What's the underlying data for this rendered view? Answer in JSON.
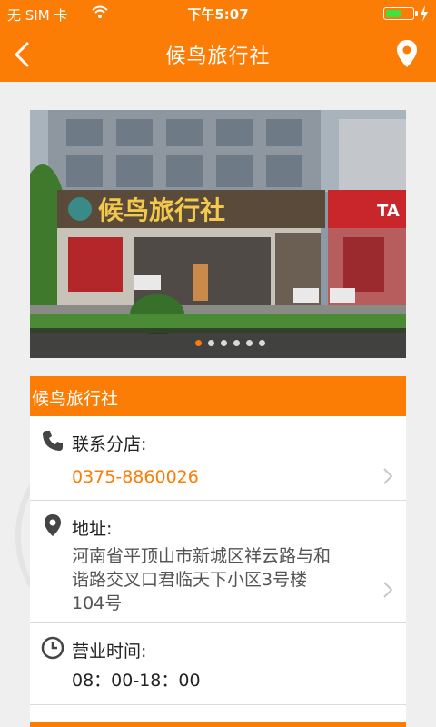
{
  "status_bar": {
    "carrier": "无 SIM 卡",
    "time": "下午5:07",
    "battery_level": 0.5
  },
  "nav": {
    "title": "候鸟旅行社",
    "back_icon": "chevron-left-icon",
    "location_icon": "map-pin-icon"
  },
  "gallery": {
    "storefront_sign": "候鸟旅行社",
    "dot_count": 6,
    "active_index": 0
  },
  "info": {
    "header": "候鸟旅行社",
    "phone_label": "联系分店:",
    "phone_value": "0375-8860026",
    "address_label": "地址:",
    "address_value_line1": "河南省平顶山市新城区祥云路与和",
    "address_value_line2": "谐路交叉口君临天下小区3号楼",
    "address_value_line3": "104号",
    "hours_label": "营业时间:",
    "hours_value": "08：00-18：00"
  },
  "colors": {
    "accent": "#fb7d06",
    "text_dark": "#222222",
    "text_gray": "#555555"
  }
}
